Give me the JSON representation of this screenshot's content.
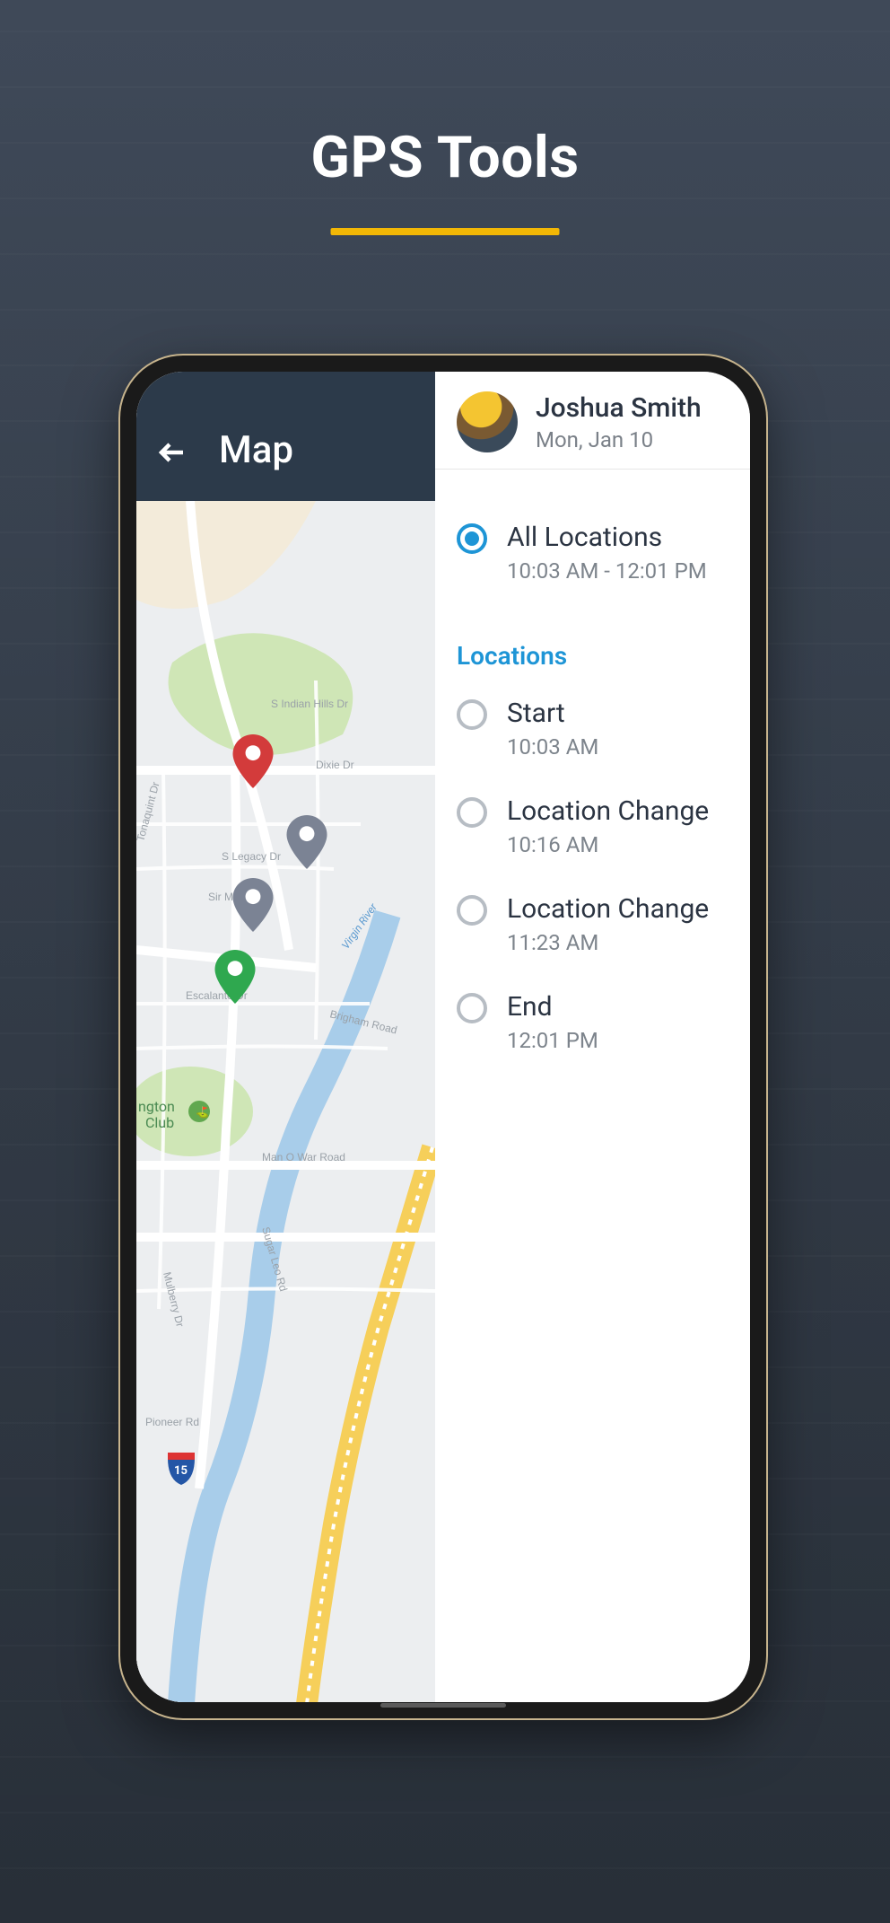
{
  "page": {
    "title": "GPS Tools",
    "accent_color": "#f2b705"
  },
  "map": {
    "header_title": "Map",
    "pins": [
      {
        "kind": "start",
        "color": "#d33b3b"
      },
      {
        "kind": "location-change",
        "color": "#7b8394"
      },
      {
        "kind": "location-change",
        "color": "#7b8394"
      },
      {
        "kind": "end",
        "color": "#2fa84f"
      }
    ],
    "labels": {
      "indian_hills": "S Indian Hills Dr",
      "dixie": "Dixie Dr",
      "legacy": "S Legacy Dr",
      "tonaquint": "Tonaquint Dr",
      "sir_monte": "Sir Monte Dr",
      "escalante": "Escalante Dr",
      "brigham": "Brigham Road",
      "manowar": "Man O War Road",
      "sugarleo": "Sugar Leo Rd",
      "mulberry": "Mulberry Dr",
      "pioneer": "Pioneer Rd",
      "virgin": "Virgin River",
      "club": "ngton\nClub",
      "highway": "15"
    }
  },
  "user": {
    "name": "Joshua Smith",
    "date": "Mon, Jan 10"
  },
  "all_locations": {
    "title": "All Locations",
    "range": "10:03 AM - 12:01 PM",
    "selected": true
  },
  "locations_label": "Locations",
  "locations": [
    {
      "title": "Start",
      "time": "10:03 AM"
    },
    {
      "title": "Location Change",
      "time": "10:16 AM"
    },
    {
      "title": "Location Change",
      "time": "11:23 AM"
    },
    {
      "title": "End",
      "time": "12:01 PM"
    }
  ]
}
